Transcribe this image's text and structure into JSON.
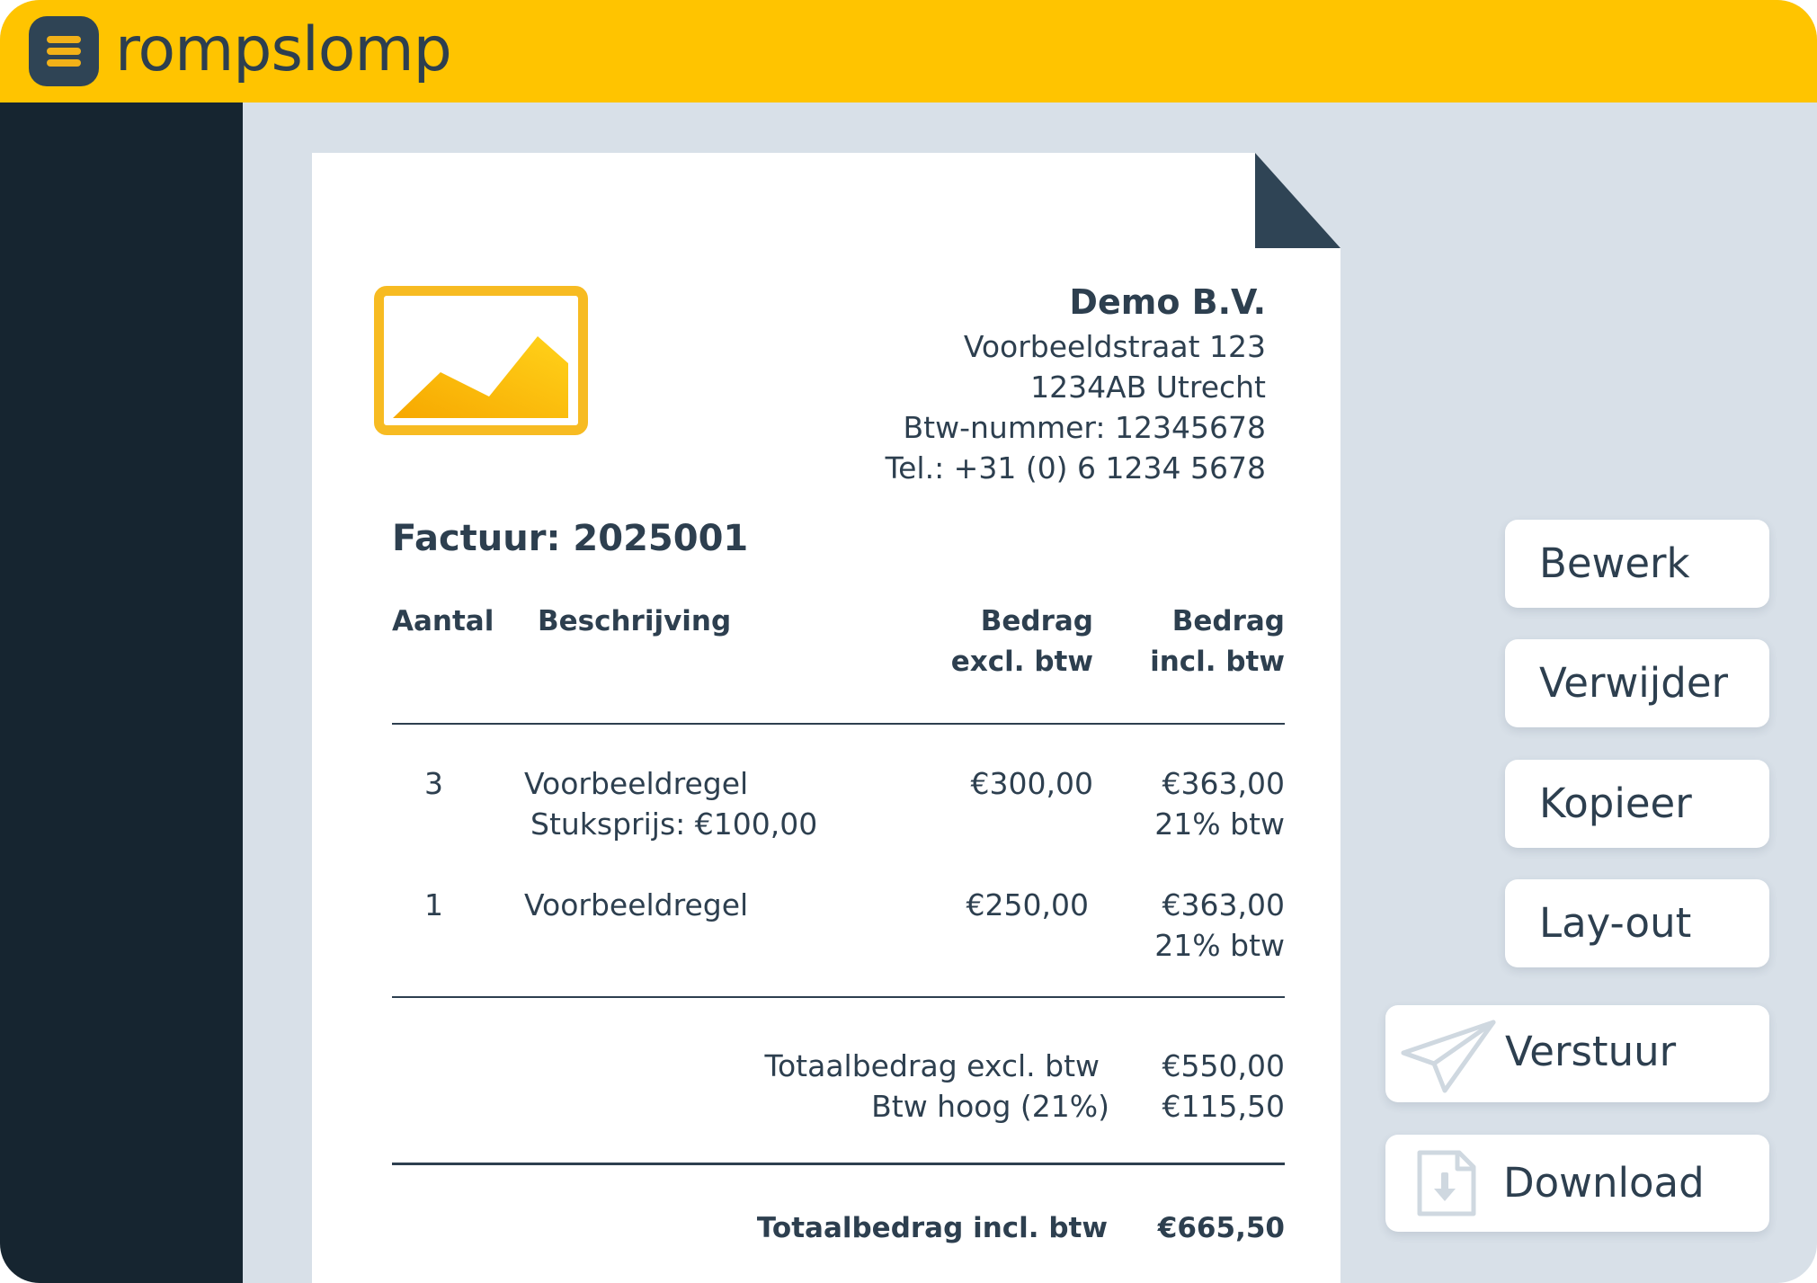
{
  "app": {
    "name": "rompslomp",
    "logo_icon": "stack-icon"
  },
  "company": {
    "name": "Demo B.V.",
    "street": "Voorbeeldstraat 123",
    "city": "1234AB Utrecht",
    "vat": "Btw-nummer: 12345678",
    "phone": "Tel.: +31 (0) 6 1234 5678"
  },
  "invoice": {
    "title": "Factuur: 2025001",
    "columns": {
      "qty": "Aantal",
      "desc": "Beschrijving",
      "excl_line1": "Bedrag",
      "excl_line2": "excl. btw",
      "incl_line1": "Bedrag",
      "incl_line2": "incl. btw"
    },
    "lines": [
      {
        "qty": "3",
        "desc": "Voorbeeldregel",
        "sub": "Stuksprijs: €100,00",
        "excl": "€300,00",
        "incl": "€363,00",
        "vat": "21% btw"
      },
      {
        "qty": "1",
        "desc": "Voorbeeldregel",
        "excl": "€250,00",
        "incl": "€363,00",
        "vat": "21% btw"
      }
    ],
    "totals": {
      "excl_label": "Totaalbedrag excl. btw",
      "excl_value": "€550,00",
      "vat_label": "Btw hoog (21%)",
      "vat_value": "€115,50",
      "incl_label": "Totaalbedrag incl. btw",
      "incl_value": "€665,50"
    }
  },
  "actions": {
    "edit": "Bewerk",
    "delete": "Verwijder",
    "copy": "Kopieer",
    "layout": "Lay-out",
    "send": "Verstuur",
    "send_icon": "paper-plane-icon",
    "download": "Download",
    "download_icon": "download-file-icon"
  },
  "colors": {
    "brand_yellow": "#ffc400",
    "sidebar": "#162530",
    "text": "#2d3f4f",
    "canvas": "#d8e0e8"
  }
}
